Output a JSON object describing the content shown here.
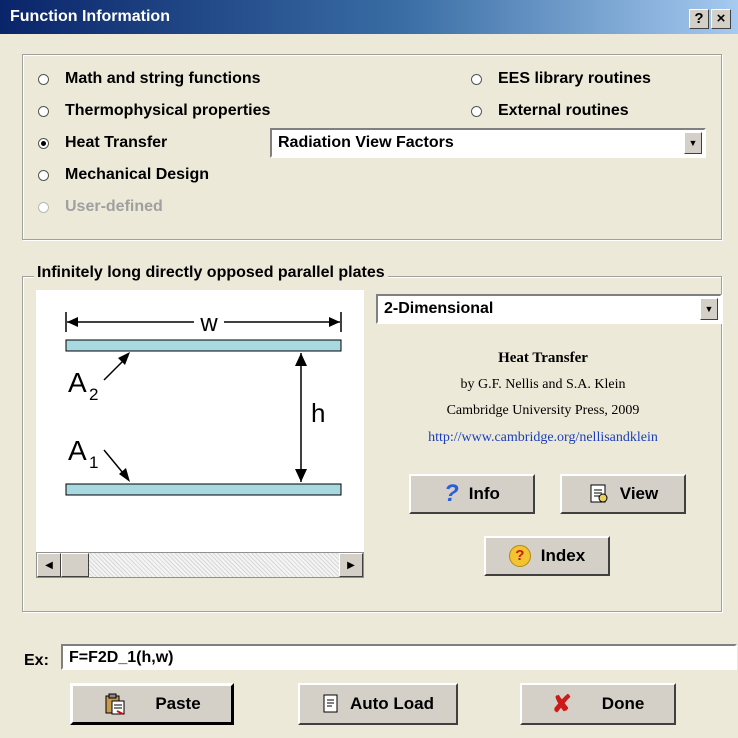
{
  "window": {
    "title": "Function Information",
    "help_glyph": "?",
    "close_glyph": "×"
  },
  "categories": {
    "left": [
      {
        "label": "Math and string functions",
        "selected": false,
        "enabled": true
      },
      {
        "label": "Thermophysical properties",
        "selected": false,
        "enabled": true
      },
      {
        "label": "Heat Transfer",
        "selected": true,
        "enabled": true
      },
      {
        "label": "Mechanical Design",
        "selected": false,
        "enabled": true
      },
      {
        "label": "User-defined",
        "selected": false,
        "enabled": false
      }
    ],
    "right": [
      {
        "label": "EES library routines",
        "selected": false,
        "enabled": true
      },
      {
        "label": "External routines",
        "selected": false,
        "enabled": true
      }
    ],
    "topic_select": {
      "value": "Radiation View Factors"
    }
  },
  "group": {
    "title": "Infinitely long directly opposed parallel plates",
    "dimension_select": {
      "value": "2-Dimensional"
    },
    "diagram": {
      "width_label": "w",
      "height_label": "h",
      "area2_label": "A",
      "area2_sub": "2",
      "area1_label": "A",
      "area1_sub": "1"
    },
    "credits": {
      "book_title": "Heat Transfer",
      "authors": "by G.F. Nellis and S.A. Klein",
      "publisher": "Cambridge University Press, 2009",
      "url": "http://www.cambridge.org/nellisandklein"
    },
    "buttons": {
      "info": "Info",
      "view": "View",
      "index": "Index"
    }
  },
  "example": {
    "label": "Ex:",
    "value": "F=F2D_1(h,w)"
  },
  "footer": {
    "paste": "Paste",
    "auto_load": "Auto Load",
    "done": "Done"
  },
  "colors": {
    "plate_fill": "#a8d8e0",
    "title_bar_start": "#0a246a",
    "url_blue": "#1a3fb8",
    "done_x": "#cc1a1a"
  }
}
